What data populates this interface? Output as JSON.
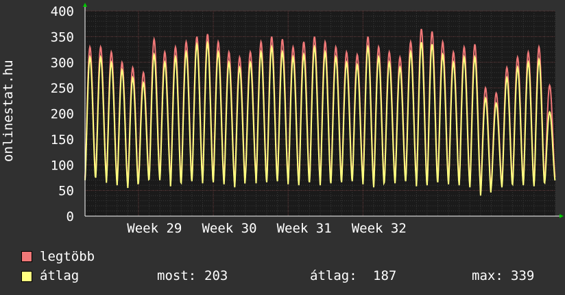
{
  "chart_data": {
    "type": "line",
    "ylabel": "onlinestat.hu",
    "xlabel": "",
    "title": "",
    "ylim": [
      0,
      400
    ],
    "yticks": [
      0,
      50,
      100,
      150,
      200,
      250,
      300,
      350,
      400
    ],
    "xticks": [
      "Week 29",
      "Week 30",
      "Week 31",
      "Week 32"
    ],
    "grid": true,
    "background": "#1a1a1a",
    "outer_background": "#303030",
    "cycles_per_day": 1,
    "days": 44,
    "series": [
      {
        "name": "legtöbb",
        "color": "#f07878",
        "daily_peaks": [
          330,
          330,
          320,
          300,
          290,
          280,
          345,
          320,
          330,
          340,
          350,
          355,
          340,
          320,
          310,
          320,
          340,
          350,
          345,
          330,
          340,
          350,
          340,
          330,
          320,
          315,
          350,
          330,
          320,
          310,
          340,
          365,
          360,
          340,
          320,
          330,
          335,
          250,
          240,
          290,
          310,
          320,
          330,
          255
        ],
        "daily_troughs": [
          75,
          80,
          70,
          65,
          60,
          72,
          78,
          75,
          62,
          70,
          72,
          68,
          70,
          66,
          60,
          80,
          68,
          70,
          72,
          66,
          65,
          70,
          64,
          68,
          70,
          72,
          66,
          60,
          70,
          68,
          72,
          62,
          64,
          70,
          66,
          64,
          60,
          45,
          62,
          60,
          66,
          64,
          62,
          70
        ]
      },
      {
        "name": "átlag",
        "color": "#ffff80",
        "daily_peaks": [
          310,
          310,
          300,
          285,
          270,
          260,
          315,
          300,
          310,
          320,
          335,
          338,
          320,
          300,
          290,
          300,
          320,
          330,
          320,
          310,
          315,
          330,
          320,
          310,
          300,
          295,
          330,
          310,
          300,
          290,
          320,
          339,
          335,
          315,
          300,
          310,
          310,
          230,
          220,
          270,
          290,
          300,
          305,
          203
        ],
        "daily_troughs": [
          70,
          75,
          65,
          60,
          55,
          65,
          72,
          70,
          58,
          65,
          68,
          64,
          66,
          62,
          56,
          76,
          64,
          66,
          68,
          62,
          60,
          66,
          60,
          64,
          66,
          68,
          62,
          56,
          66,
          64,
          68,
          58,
          60,
          66,
          62,
          60,
          56,
          40,
          58,
          56,
          62,
          60,
          58,
          65
        ]
      }
    ],
    "stats": {
      "most_label": "most:",
      "most_value": "203",
      "atlag_label": "átlag:",
      "atlag_value": "187",
      "max_label": "max:",
      "max_value": "339"
    }
  }
}
